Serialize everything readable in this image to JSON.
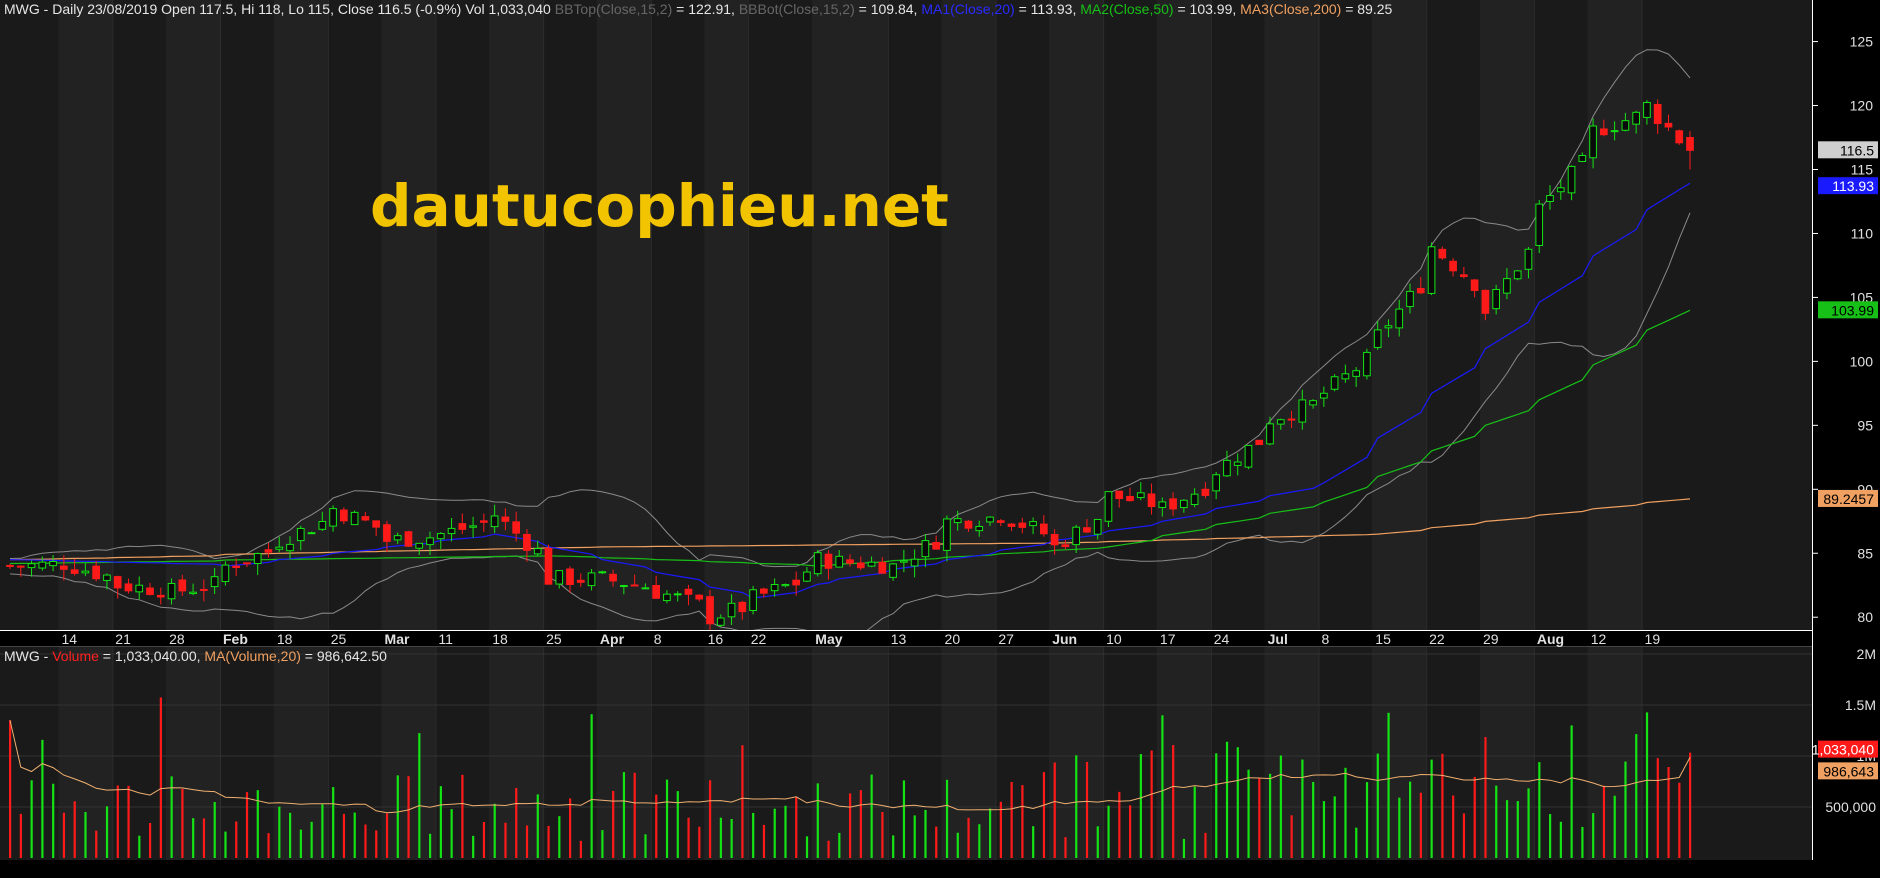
{
  "header_price": {
    "prefix": "MWG - Daily 23/08/2019 Open 117.5, Hi 118, Lo 115, Close 116.5 (-0.9%) Vol 1,033,040",
    "bbtop_label": "BBTop(Close,15,2)",
    "bbtop_value": " = 122.91, ",
    "bbbot_label": "BBBot(Close,15,2)",
    "bbbot_value": " = 109.84, ",
    "ma1_label": "MA1(Close,20)",
    "ma1_value": " = 113.93, ",
    "ma2_label": "MA2(Close,50)",
    "ma2_value": " = 103.99, ",
    "ma3_label": "MA3(Close,200)",
    "ma3_value": " = 89.25"
  },
  "header_volume": {
    "prefix": "MWG - ",
    "vol_label": "Volume",
    "vol_value": " = 1,033,040.00, ",
    "mavol_label": "MA(Volume,20)",
    "mavol_value": " = 986,642.50"
  },
  "watermark": "dautucophieu.net",
  "colors": {
    "background": "#000000",
    "up": "#14e314",
    "down": "#ff1a1a",
    "bband": "#8a8a8a",
    "ma1": "#1a1aff",
    "ma2": "#17c017",
    "ma3": "#f0a060",
    "volume_ma": "#f0b070",
    "axis_text": "#e0e0e0"
  },
  "chart_data": {
    "type": "candlestick",
    "title": "MWG - Daily",
    "price_axis": {
      "ylim": [
        79,
        127
      ],
      "ticks": [
        80,
        85,
        90,
        95,
        100,
        105,
        110,
        115,
        120,
        125
      ]
    },
    "volume_axis": {
      "ylim": [
        0,
        2000000
      ],
      "ticks": [
        500000,
        1000000,
        1500000,
        2000000
      ],
      "tick_labels": [
        "500,000",
        "1M",
        "1.5M",
        "2M"
      ]
    },
    "x_tick_labels": [
      "14",
      "21",
      "28",
      "Feb",
      "18",
      "25",
      "Mar",
      "11",
      "18",
      "25",
      "Apr",
      "8",
      "16",
      "22",
      "May",
      "13",
      "20",
      "27",
      "Jun",
      "10",
      "17",
      "24",
      "Jul",
      "8",
      "15",
      "22",
      "29",
      "Aug",
      "12",
      "19"
    ],
    "x_tick_dates": [
      "2019-01-14",
      "2019-01-21",
      "2019-01-28",
      "2019-02-11",
      "2019-02-18",
      "2019-02-25",
      "2019-03-04",
      "2019-03-11",
      "2019-03-18",
      "2019-03-25",
      "2019-04-01",
      "2019-04-08",
      "2019-04-16",
      "2019-04-22",
      "2019-05-02",
      "2019-05-13",
      "2019-05-20",
      "2019-05-27",
      "2019-06-03",
      "2019-06-10",
      "2019-06-17",
      "2019-06-24",
      "2019-07-01",
      "2019-07-08",
      "2019-07-15",
      "2019-07-22",
      "2019-07-29",
      "2019-08-05",
      "2019-08-12",
      "2019-08-19"
    ],
    "price_keypoints": [
      {
        "date": "2019-01-07",
        "close": 84.0
      },
      {
        "date": "2019-01-14",
        "close": 84.2
      },
      {
        "date": "2019-01-21",
        "close": 82.5
      },
      {
        "date": "2019-01-28",
        "close": 82.0
      },
      {
        "date": "2019-02-11",
        "close": 84.0
      },
      {
        "date": "2019-02-18",
        "close": 86.0
      },
      {
        "date": "2019-02-25",
        "close": 88.5
      },
      {
        "date": "2019-03-04",
        "close": 86.0
      },
      {
        "date": "2019-03-11",
        "close": 86.5
      },
      {
        "date": "2019-03-18",
        "close": 88.0
      },
      {
        "date": "2019-03-25",
        "close": 83.0
      },
      {
        "date": "2019-04-01",
        "close": 83.0
      },
      {
        "date": "2019-04-08",
        "close": 82.0
      },
      {
        "date": "2019-04-16",
        "close": 80.0
      },
      {
        "date": "2019-04-22",
        "close": 81.5
      },
      {
        "date": "2019-05-02",
        "close": 84.5
      },
      {
        "date": "2019-05-13",
        "close": 84.0
      },
      {
        "date": "2019-05-20",
        "close": 87.5
      },
      {
        "date": "2019-05-27",
        "close": 88.0
      },
      {
        "date": "2019-06-03",
        "close": 85.5
      },
      {
        "date": "2019-06-10",
        "close": 89.5
      },
      {
        "date": "2019-06-17",
        "close": 88.5
      },
      {
        "date": "2019-06-24",
        "close": 91.5
      },
      {
        "date": "2019-07-01",
        "close": 95.5
      },
      {
        "date": "2019-07-08",
        "close": 97.5
      },
      {
        "date": "2019-07-15",
        "close": 102.0
      },
      {
        "date": "2019-07-22",
        "close": 109.0
      },
      {
        "date": "2019-07-29",
        "close": 104.0
      },
      {
        "date": "2019-08-05",
        "close": 112.0
      },
      {
        "date": "2019-08-12",
        "close": 118.0
      },
      {
        "date": "2019-08-19",
        "close": 120.0
      },
      {
        "date": "2019-08-23",
        "close": 116.5
      }
    ],
    "last_bar": {
      "date": "2019-08-23",
      "open": 117.5,
      "high": 118,
      "low": 115,
      "close": 116.5,
      "volume": 1033040
    },
    "indicators": {
      "ma1_close_20": {
        "last": 113.93,
        "keypoints": [
          {
            "date": "2019-01-07",
            "v": 84.5
          },
          {
            "date": "2019-02-11",
            "v": 84.0
          },
          {
            "date": "2019-03-18",
            "v": 86.5
          },
          {
            "date": "2019-04-22",
            "v": 81.5
          },
          {
            "date": "2019-05-20",
            "v": 84.5
          },
          {
            "date": "2019-06-17",
            "v": 87.5
          },
          {
            "date": "2019-07-08",
            "v": 90.5
          },
          {
            "date": "2019-07-29",
            "v": 101.0
          },
          {
            "date": "2019-08-23",
            "v": 113.93
          }
        ]
      },
      "ma2_close_50": {
        "last": 103.99,
        "keypoints": [
          {
            "date": "2019-01-07",
            "v": 84.2
          },
          {
            "date": "2019-03-25",
            "v": 84.8
          },
          {
            "date": "2019-05-02",
            "v": 84.0
          },
          {
            "date": "2019-06-10",
            "v": 85.5
          },
          {
            "date": "2019-07-08",
            "v": 89.0
          },
          {
            "date": "2019-08-05",
            "v": 97.0
          },
          {
            "date": "2019-08-23",
            "v": 103.99
          }
        ]
      },
      "ma3_close_200": {
        "last": 89.2457,
        "keypoints": [
          {
            "date": "2019-01-07",
            "v": 84.5
          },
          {
            "date": "2019-04-01",
            "v": 85.5
          },
          {
            "date": "2019-06-03",
            "v": 85.8
          },
          {
            "date": "2019-07-15",
            "v": 86.5
          },
          {
            "date": "2019-08-23",
            "v": 89.25
          }
        ]
      },
      "bbtop_close_15_2": {
        "last": 122.91
      },
      "bbbot_close_15_2": {
        "last": 109.84
      },
      "volume_ma_20": {
        "last": 986642.5
      }
    },
    "right_labels": {
      "close": "116.5",
      "ma1": "113.93",
      "ma2": "103.99",
      "ma3": "89.2457",
      "volume": "1,033,040",
      "volume_ma": "986,643"
    }
  }
}
